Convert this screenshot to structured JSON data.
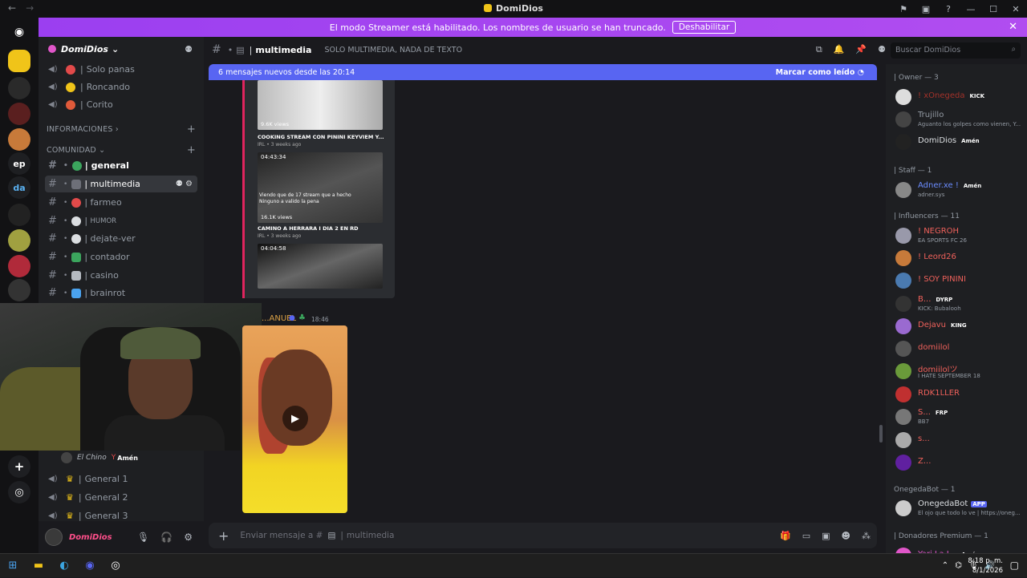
{
  "titlebar": {
    "title": "DomiDios"
  },
  "banner": {
    "text": "El modo Streamer está habilitado. Los nombres de usuario se han truncado.",
    "button": "Deshabilitar"
  },
  "servers": [
    "ep",
    "da"
  ],
  "guild": {
    "name": "DomiDios"
  },
  "sidebar": {
    "voice_top": [
      {
        "label": "Solo panas",
        "color": "#e24a4a"
      },
      {
        "label": "Roncando",
        "color": "#f0c419"
      },
      {
        "label": "Corito",
        "color": "#e05a3a"
      }
    ],
    "categories": {
      "info": "INFORMACIONES",
      "comunidad": "COMUNIDAD"
    },
    "channels": [
      {
        "label": "general",
        "color": "#3ba55d",
        "bold": true
      },
      {
        "label": "multimedia",
        "color": "#949ba4",
        "active": true
      },
      {
        "label": "farmeo",
        "color": "#e24a4a"
      },
      {
        "label": "HUMOR",
        "color": "#dbdee1"
      },
      {
        "label": "dejate-ver",
        "color": "#dbdee1"
      },
      {
        "label": "contador",
        "color": "#3ba55d"
      },
      {
        "label": "casino",
        "color": "#b5bac1"
      },
      {
        "label": "brainrot",
        "color": "#4aa3f0"
      }
    ],
    "webcam_user": "El Chino",
    "webcam_badge": "Amén",
    "voice_bottom": [
      "General 1",
      "General 2",
      "General 3"
    ]
  },
  "user": {
    "name": "DomiDios"
  },
  "header": {
    "channel": "multimedia",
    "topic": "SOLO MULTIMEDIA, NADA DE TEXTO"
  },
  "search": {
    "placeholder": "Buscar DomiDios"
  },
  "newbar": {
    "text": "6 mensajes nuevos desde las 20:14",
    "action": "Marcar como leído"
  },
  "embed": {
    "videos": [
      {
        "views": "9.6K views",
        "title": "COOKING STREAM CON PININI KEYVIEM Y...",
        "meta": "IRL • 3 weeks ago"
      },
      {
        "duration": "04:43:34",
        "views": "16.1K views",
        "title": "CAMINO A HERRARA I DIA 2 EN RD",
        "meta": "IRL • 3 weeks ago",
        "overlay": "Viendo que de 17 stream que a hecho Ninguno a valido la pena"
      },
      {
        "duration": "04:04:58"
      }
    ]
  },
  "message": {
    "author": "...ANUEL",
    "time": "18:46"
  },
  "composer": {
    "placeholder": "Enviar mensaje a #",
    "channel": "multimedia"
  },
  "members": {
    "roles": [
      {
        "label": "| Owner — 3"
      },
      {
        "label": "| Staff — 1"
      },
      {
        "label": "| Influencers — 11"
      },
      {
        "label": "OnegedaBot — 1"
      },
      {
        "label": "| Donadores Premium — 1"
      }
    ],
    "list": [
      {
        "name": "! xOnegeda",
        "status": "",
        "tag": "KICK",
        "tagColor": "#53fc18",
        "nameColor": "#a3322a"
      },
      {
        "name": "Trujillo",
        "status": "Aguanto los golpes como vienen, Y...",
        "nameColor": "#949ba4"
      },
      {
        "name": "DomiDios",
        "status": "",
        "tag": "Amén",
        "tagColor": "#e24a4a",
        "nameColor": "#dbdee1"
      },
      {
        "name": "Adner.xe !",
        "status": "adner.sys",
        "tag": "Amén",
        "tagColor": "#e24a4a",
        "nameColor": "#6b8cff"
      },
      {
        "name": "! NEGROH",
        "status": "EA SPORTS FC 26",
        "nameColor": "#f0615b"
      },
      {
        "name": "! Leord26",
        "status": "",
        "nameColor": "#f0615b"
      },
      {
        "name": "! SOY PININI",
        "status": "",
        "nameColor": "#f0615b"
      },
      {
        "name": "B...",
        "status": "KICK: Bubalooh",
        "tag": "DYRP",
        "tagColor": "#3ba55d",
        "nameColor": "#f0615b"
      },
      {
        "name": "Dejavu",
        "status": "",
        "tag": "KING",
        "tagColor": "#f0c419",
        "nameColor": "#f0615b"
      },
      {
        "name": "domiilol",
        "status": "",
        "nameColor": "#f0615b"
      },
      {
        "name": "domiilolツ",
        "status": "I HATE SEPTEMBER 18",
        "nameColor": "#f0615b"
      },
      {
        "name": "RDK1LLER",
        "status": "",
        "nameColor": "#f0615b"
      },
      {
        "name": "S...",
        "status": "BB7",
        "tag": "FRP",
        "tagColor": "#b5bac1",
        "nameColor": "#f0615b"
      },
      {
        "name": "s...",
        "status": "",
        "nameColor": "#f0615b"
      },
      {
        "name": "Z...",
        "status": "",
        "nameColor": "#f0615b"
      },
      {
        "name": "OnegedaBot",
        "status": "El ojo que todo lo ve | https://oneg...",
        "tag": "APP",
        "tagColor": "#5865f2",
        "nameColor": "#dbdee1"
      },
      {
        "name": "Yari La J...",
        "status": "",
        "tag": "Amén",
        "tagColor": "#e24a4a",
        "nameColor": "#e056c9"
      }
    ]
  },
  "taskbar": {
    "time": "8:18 p. m.",
    "date": "8/1/2026"
  },
  "colors": {
    "accent": "#5865f2",
    "banner": "#b14df0",
    "streamer_red": "#e0245e"
  }
}
